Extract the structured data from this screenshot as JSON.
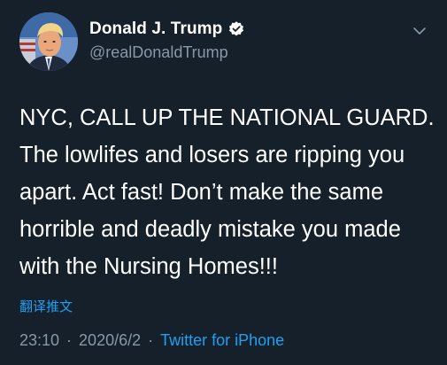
{
  "author": {
    "display_name": "Donald J. Trump",
    "handle": "@realDonaldTrump",
    "verified": true
  },
  "tweet": {
    "text": "NYC, CALL UP THE NATIONAL GUARD. The lowlifes and losers are ripping you apart. Act fast! Don’t make the same horrible and deadly mistake you made with the Nursing Homes!!!",
    "translate_label": "翻译推文",
    "time": "23:10",
    "date": "2020/6/2",
    "separator": "·",
    "source": "Twitter for iPhone"
  },
  "icons": {
    "verified": "verified-badge-icon",
    "menu": "chevron-down-icon"
  },
  "colors": {
    "background": "#15202b",
    "text": "#ffffff",
    "secondary": "#8899a6",
    "accent": "#1da1f2"
  }
}
